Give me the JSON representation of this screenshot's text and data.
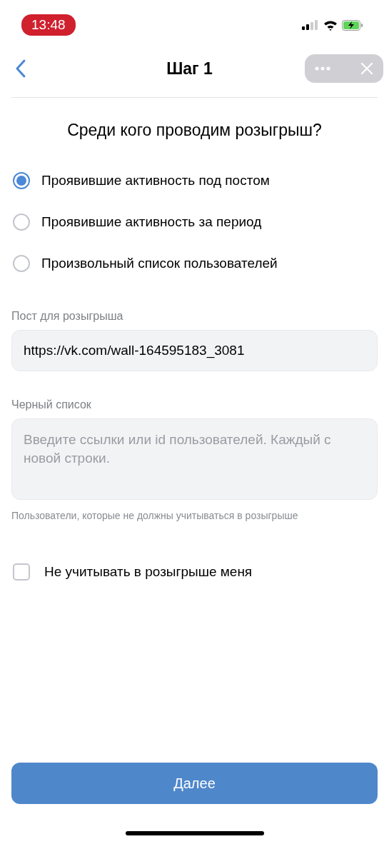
{
  "status_bar": {
    "time": "13:48"
  },
  "nav": {
    "title": "Шаг 1"
  },
  "question": "Среди кого проводим розыгрыш?",
  "options": [
    {
      "label": "Проявившие активность под постом",
      "selected": true
    },
    {
      "label": "Проявившие активность за период",
      "selected": false
    },
    {
      "label": "Произвольный список пользователей",
      "selected": false
    }
  ],
  "post_field": {
    "label": "Пост для розыгрыша",
    "value": "https://vk.com/wall-164595183_3081"
  },
  "blacklist": {
    "label": "Черный список",
    "placeholder": "Введите ссылки или id пользователей. Каждый с новой строки.",
    "hint": "Пользователи, которые не должны учитываться в розыгрыше"
  },
  "exclude_me": {
    "label": "Не учитывать в розыгрыше меня",
    "checked": false
  },
  "next_button": "Далее"
}
